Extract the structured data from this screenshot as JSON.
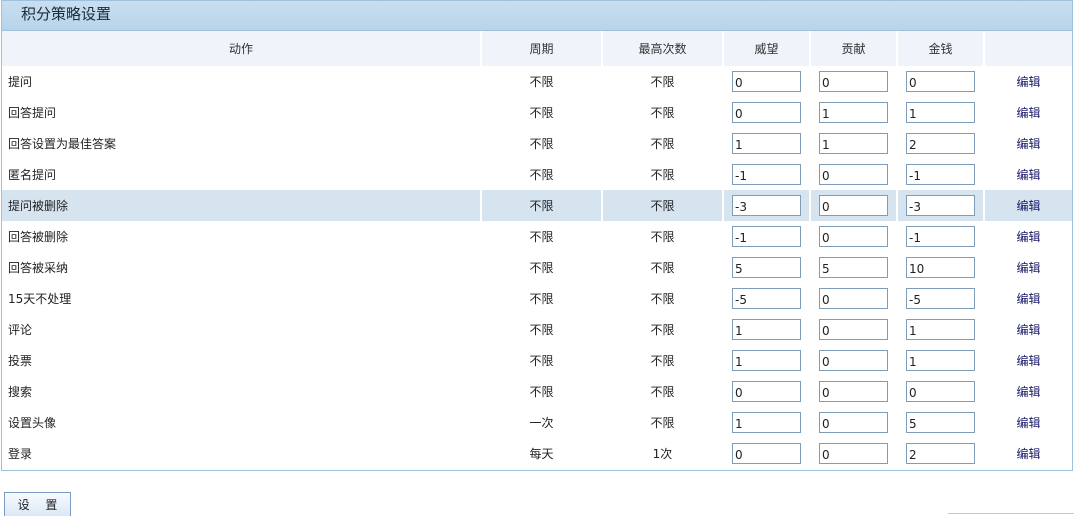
{
  "panel": {
    "title": "积分策略设置"
  },
  "columns": {
    "action": "动作",
    "period": "周期",
    "max_times": "最高次数",
    "prestige": "威望",
    "contribution": "贡献",
    "money": "金钱"
  },
  "rows": [
    {
      "action": "提问",
      "period": "不限",
      "max_times": "不限",
      "prestige": "0",
      "contribution": "0",
      "money": "0",
      "edit": "编辑"
    },
    {
      "action": "回答提问",
      "period": "不限",
      "max_times": "不限",
      "prestige": "0",
      "contribution": "1",
      "money": "1",
      "edit": "编辑"
    },
    {
      "action": "回答设置为最佳答案",
      "period": "不限",
      "max_times": "不限",
      "prestige": "1",
      "contribution": "1",
      "money": "2",
      "edit": "编辑"
    },
    {
      "action": "匿名提问",
      "period": "不限",
      "max_times": "不限",
      "prestige": "-1",
      "contribution": "0",
      "money": "-1",
      "edit": "编辑"
    },
    {
      "action": "提问被删除",
      "period": "不限",
      "max_times": "不限",
      "prestige": "-3",
      "contribution": "0",
      "money": "-3",
      "edit": "编辑"
    },
    {
      "action": "回答被删除",
      "period": "不限",
      "max_times": "不限",
      "prestige": "-1",
      "contribution": "0",
      "money": "-1",
      "edit": "编辑"
    },
    {
      "action": "回答被采纳",
      "period": "不限",
      "max_times": "不限",
      "prestige": "5",
      "contribution": "5",
      "money": "10",
      "edit": "编辑"
    },
    {
      "action": "15天不处理",
      "period": "不限",
      "max_times": "不限",
      "prestige": "-5",
      "contribution": "0",
      "money": "-5",
      "edit": "编辑"
    },
    {
      "action": "评论",
      "period": "不限",
      "max_times": "不限",
      "prestige": "1",
      "contribution": "0",
      "money": "1",
      "edit": "编辑"
    },
    {
      "action": "投票",
      "period": "不限",
      "max_times": "不限",
      "prestige": "1",
      "contribution": "0",
      "money": "1",
      "edit": "编辑"
    },
    {
      "action": "搜索",
      "period": "不限",
      "max_times": "不限",
      "prestige": "0",
      "contribution": "0",
      "money": "0",
      "edit": "编辑"
    },
    {
      "action": "设置头像",
      "period": "一次",
      "max_times": "不限",
      "prestige": "1",
      "contribution": "0",
      "money": "5",
      "edit": "编辑"
    },
    {
      "action": "登录",
      "period": "每天",
      "max_times": "1次",
      "prestige": "0",
      "contribution": "0",
      "money": "2",
      "edit": "编辑"
    }
  ],
  "highlighted_row": 4,
  "submit_label": "设 置"
}
